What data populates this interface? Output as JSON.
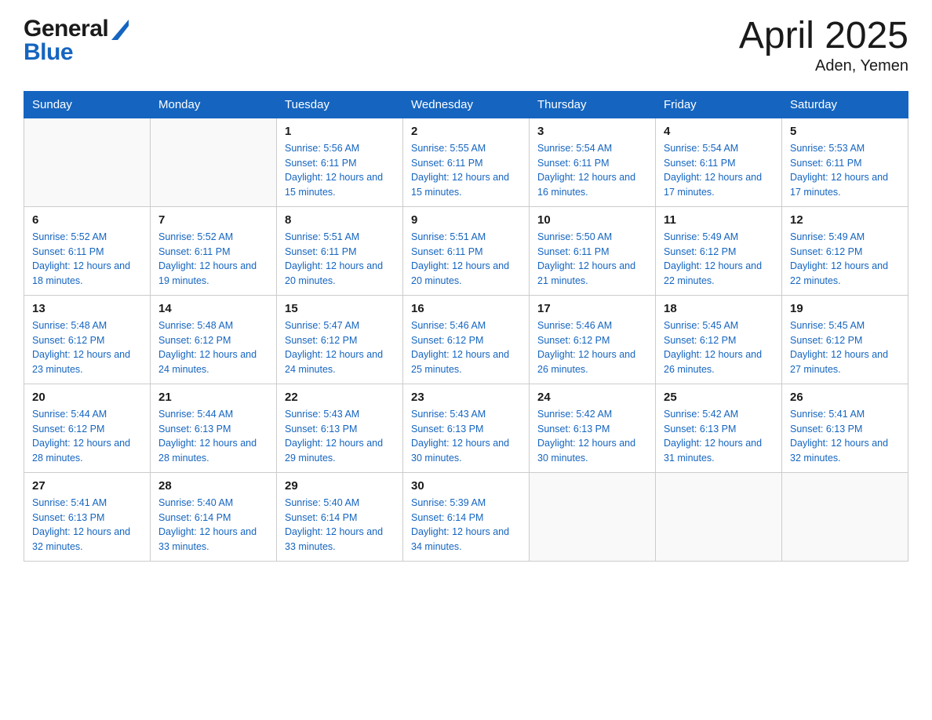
{
  "header": {
    "logo_general": "General",
    "logo_blue": "Blue",
    "month_title": "April 2025",
    "location": "Aden, Yemen"
  },
  "days_of_week": [
    "Sunday",
    "Monday",
    "Tuesday",
    "Wednesday",
    "Thursday",
    "Friday",
    "Saturday"
  ],
  "weeks": [
    [
      {
        "day": "",
        "sunrise": "",
        "sunset": "",
        "daylight": ""
      },
      {
        "day": "",
        "sunrise": "",
        "sunset": "",
        "daylight": ""
      },
      {
        "day": "1",
        "sunrise": "Sunrise: 5:56 AM",
        "sunset": "Sunset: 6:11 PM",
        "daylight": "Daylight: 12 hours and 15 minutes."
      },
      {
        "day": "2",
        "sunrise": "Sunrise: 5:55 AM",
        "sunset": "Sunset: 6:11 PM",
        "daylight": "Daylight: 12 hours and 15 minutes."
      },
      {
        "day": "3",
        "sunrise": "Sunrise: 5:54 AM",
        "sunset": "Sunset: 6:11 PM",
        "daylight": "Daylight: 12 hours and 16 minutes."
      },
      {
        "day": "4",
        "sunrise": "Sunrise: 5:54 AM",
        "sunset": "Sunset: 6:11 PM",
        "daylight": "Daylight: 12 hours and 17 minutes."
      },
      {
        "day": "5",
        "sunrise": "Sunrise: 5:53 AM",
        "sunset": "Sunset: 6:11 PM",
        "daylight": "Daylight: 12 hours and 17 minutes."
      }
    ],
    [
      {
        "day": "6",
        "sunrise": "Sunrise: 5:52 AM",
        "sunset": "Sunset: 6:11 PM",
        "daylight": "Daylight: 12 hours and 18 minutes."
      },
      {
        "day": "7",
        "sunrise": "Sunrise: 5:52 AM",
        "sunset": "Sunset: 6:11 PM",
        "daylight": "Daylight: 12 hours and 19 minutes."
      },
      {
        "day": "8",
        "sunrise": "Sunrise: 5:51 AM",
        "sunset": "Sunset: 6:11 PM",
        "daylight": "Daylight: 12 hours and 20 minutes."
      },
      {
        "day": "9",
        "sunrise": "Sunrise: 5:51 AM",
        "sunset": "Sunset: 6:11 PM",
        "daylight": "Daylight: 12 hours and 20 minutes."
      },
      {
        "day": "10",
        "sunrise": "Sunrise: 5:50 AM",
        "sunset": "Sunset: 6:11 PM",
        "daylight": "Daylight: 12 hours and 21 minutes."
      },
      {
        "day": "11",
        "sunrise": "Sunrise: 5:49 AM",
        "sunset": "Sunset: 6:12 PM",
        "daylight": "Daylight: 12 hours and 22 minutes."
      },
      {
        "day": "12",
        "sunrise": "Sunrise: 5:49 AM",
        "sunset": "Sunset: 6:12 PM",
        "daylight": "Daylight: 12 hours and 22 minutes."
      }
    ],
    [
      {
        "day": "13",
        "sunrise": "Sunrise: 5:48 AM",
        "sunset": "Sunset: 6:12 PM",
        "daylight": "Daylight: 12 hours and 23 minutes."
      },
      {
        "day": "14",
        "sunrise": "Sunrise: 5:48 AM",
        "sunset": "Sunset: 6:12 PM",
        "daylight": "Daylight: 12 hours and 24 minutes."
      },
      {
        "day": "15",
        "sunrise": "Sunrise: 5:47 AM",
        "sunset": "Sunset: 6:12 PM",
        "daylight": "Daylight: 12 hours and 24 minutes."
      },
      {
        "day": "16",
        "sunrise": "Sunrise: 5:46 AM",
        "sunset": "Sunset: 6:12 PM",
        "daylight": "Daylight: 12 hours and 25 minutes."
      },
      {
        "day": "17",
        "sunrise": "Sunrise: 5:46 AM",
        "sunset": "Sunset: 6:12 PM",
        "daylight": "Daylight: 12 hours and 26 minutes."
      },
      {
        "day": "18",
        "sunrise": "Sunrise: 5:45 AM",
        "sunset": "Sunset: 6:12 PM",
        "daylight": "Daylight: 12 hours and 26 minutes."
      },
      {
        "day": "19",
        "sunrise": "Sunrise: 5:45 AM",
        "sunset": "Sunset: 6:12 PM",
        "daylight": "Daylight: 12 hours and 27 minutes."
      }
    ],
    [
      {
        "day": "20",
        "sunrise": "Sunrise: 5:44 AM",
        "sunset": "Sunset: 6:12 PM",
        "daylight": "Daylight: 12 hours and 28 minutes."
      },
      {
        "day": "21",
        "sunrise": "Sunrise: 5:44 AM",
        "sunset": "Sunset: 6:13 PM",
        "daylight": "Daylight: 12 hours and 28 minutes."
      },
      {
        "day": "22",
        "sunrise": "Sunrise: 5:43 AM",
        "sunset": "Sunset: 6:13 PM",
        "daylight": "Daylight: 12 hours and 29 minutes."
      },
      {
        "day": "23",
        "sunrise": "Sunrise: 5:43 AM",
        "sunset": "Sunset: 6:13 PM",
        "daylight": "Daylight: 12 hours and 30 minutes."
      },
      {
        "day": "24",
        "sunrise": "Sunrise: 5:42 AM",
        "sunset": "Sunset: 6:13 PM",
        "daylight": "Daylight: 12 hours and 30 minutes."
      },
      {
        "day": "25",
        "sunrise": "Sunrise: 5:42 AM",
        "sunset": "Sunset: 6:13 PM",
        "daylight": "Daylight: 12 hours and 31 minutes."
      },
      {
        "day": "26",
        "sunrise": "Sunrise: 5:41 AM",
        "sunset": "Sunset: 6:13 PM",
        "daylight": "Daylight: 12 hours and 32 minutes."
      }
    ],
    [
      {
        "day": "27",
        "sunrise": "Sunrise: 5:41 AM",
        "sunset": "Sunset: 6:13 PM",
        "daylight": "Daylight: 12 hours and 32 minutes."
      },
      {
        "day": "28",
        "sunrise": "Sunrise: 5:40 AM",
        "sunset": "Sunset: 6:14 PM",
        "daylight": "Daylight: 12 hours and 33 minutes."
      },
      {
        "day": "29",
        "sunrise": "Sunrise: 5:40 AM",
        "sunset": "Sunset: 6:14 PM",
        "daylight": "Daylight: 12 hours and 33 minutes."
      },
      {
        "day": "30",
        "sunrise": "Sunrise: 5:39 AM",
        "sunset": "Sunset: 6:14 PM",
        "daylight": "Daylight: 12 hours and 34 minutes."
      },
      {
        "day": "",
        "sunrise": "",
        "sunset": "",
        "daylight": ""
      },
      {
        "day": "",
        "sunrise": "",
        "sunset": "",
        "daylight": ""
      },
      {
        "day": "",
        "sunrise": "",
        "sunset": "",
        "daylight": ""
      }
    ]
  ]
}
